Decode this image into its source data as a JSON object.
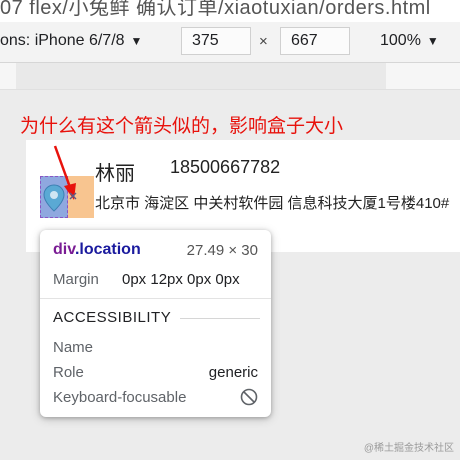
{
  "browser": {
    "url_fragment": "07 flex/小兔鲜 确认订单/xiaotuxian/orders.html"
  },
  "device_toolbar": {
    "device_label": "ons: iPhone 6/7/8",
    "width_value": "375",
    "times_sign": "×",
    "height_value": "667",
    "zoom_label": "100%",
    "caret": "▼"
  },
  "page": {
    "question": "为什么有这个箭头似的，影响盒子大小",
    "contact_name": "林丽",
    "contact_phone": "18500667782",
    "address": "北京市 海淀区 中关村软件园 信息科技大厦1号楼410#"
  },
  "tooltip": {
    "tag": "div",
    "class_name": ".location",
    "size": "27.49 × 30",
    "margin_label": "Margin",
    "margin_value": "0px 12px 0px 0px",
    "section": "ACCESSIBILITY",
    "name_label": "Name",
    "role_label": "Role",
    "role_value": "generic",
    "focusable_label": "Keyboard-focusable"
  },
  "watermark": "@稀土掘金技术社区",
  "colors": {
    "annotation_red": "#e8120c",
    "content_highlight": "#6f8fd6",
    "margin_highlight": "#f6b26b"
  }
}
